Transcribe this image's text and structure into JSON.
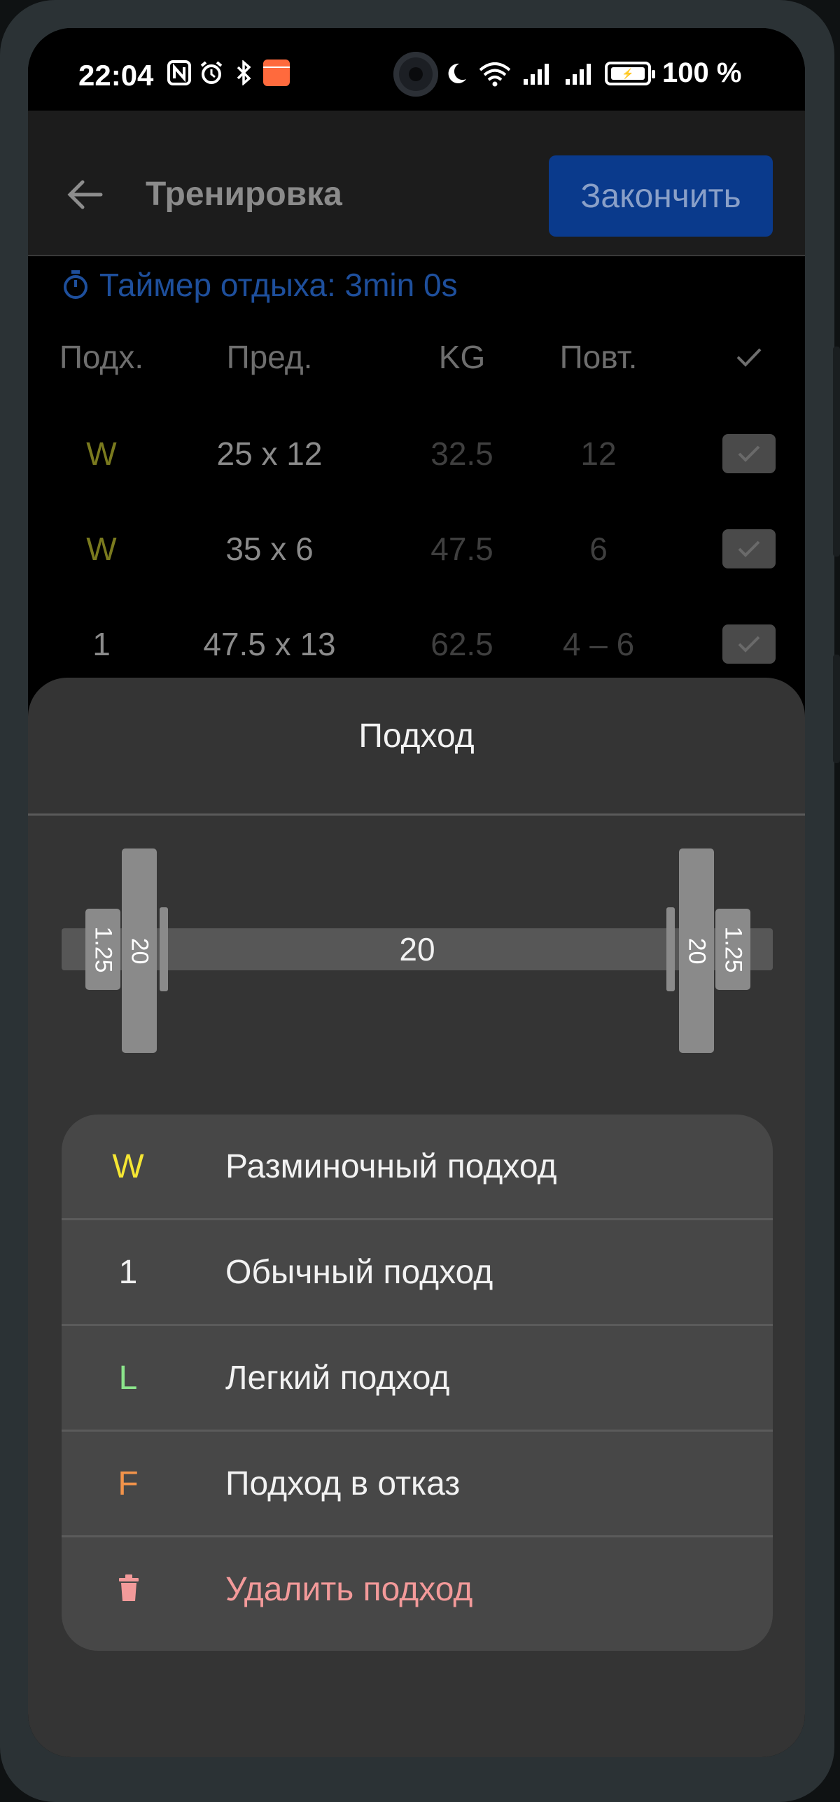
{
  "status_bar": {
    "time": "22:04",
    "battery_text": "100 %",
    "left_icons": [
      "nfc-icon",
      "alarm-icon",
      "bluetooth-icon",
      "calendar-icon"
    ],
    "right_icons": [
      "moon-icon",
      "wifi-icon",
      "signal-icon",
      "signal-icon",
      "battery-icon"
    ]
  },
  "app_bar": {
    "title": "Тренировка",
    "finish_label": "Закончить"
  },
  "timer": {
    "label": "Таймер отдыха: 3min 0s"
  },
  "table": {
    "headers": [
      "Подх.",
      "Пред.",
      "KG",
      "Повт.",
      "✓"
    ],
    "rows": [
      {
        "set": "W",
        "prev": "25 x 12",
        "kg": "32.5",
        "reps": "12"
      },
      {
        "set": "W",
        "prev": "35 x 6",
        "kg": "47.5",
        "reps": "6"
      },
      {
        "set": "1",
        "prev": "47.5 x 13",
        "kg": "62.5",
        "reps": "4 – 6"
      }
    ]
  },
  "sheet": {
    "title": "Подход",
    "barbell": {
      "bar_weight": "20",
      "plates_left": [
        "1.25",
        "20"
      ],
      "plates_right": [
        "20",
        "1.25"
      ]
    },
    "menu": [
      {
        "badge": "W",
        "label": "Разминочный подход",
        "color": "#f5e633"
      },
      {
        "badge": "1",
        "label": "Обычный подход",
        "color": "#f2f2f2"
      },
      {
        "badge": "L",
        "label": "Легкий подход",
        "color": "#8be58b"
      },
      {
        "badge": "F",
        "label": "Подход в отказ",
        "color": "#f2934a"
      },
      {
        "badge": "",
        "label": "Удалить подход",
        "color": "#f39a9a",
        "icon": "trash-icon"
      }
    ]
  },
  "colors": {
    "accent_blue": "#0a3a8c",
    "timer_blue": "#1e4f9c",
    "warmup_yellow": "#f5e633",
    "delete_red": "#f39a9a"
  }
}
